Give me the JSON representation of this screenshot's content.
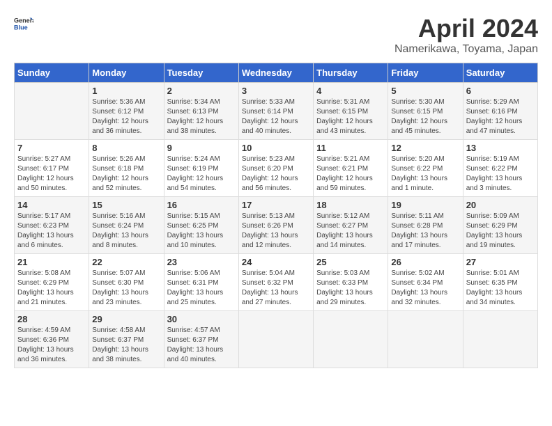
{
  "logo": {
    "line1": "General",
    "line2": "Blue"
  },
  "title": "April 2024",
  "subtitle": "Namerikawa, Toyama, Japan",
  "weekdays": [
    "Sunday",
    "Monday",
    "Tuesday",
    "Wednesday",
    "Thursday",
    "Friday",
    "Saturday"
  ],
  "weeks": [
    [
      {
        "day": "",
        "info": ""
      },
      {
        "day": "1",
        "info": "Sunrise: 5:36 AM\nSunset: 6:12 PM\nDaylight: 12 hours\nand 36 minutes."
      },
      {
        "day": "2",
        "info": "Sunrise: 5:34 AM\nSunset: 6:13 PM\nDaylight: 12 hours\nand 38 minutes."
      },
      {
        "day": "3",
        "info": "Sunrise: 5:33 AM\nSunset: 6:14 PM\nDaylight: 12 hours\nand 40 minutes."
      },
      {
        "day": "4",
        "info": "Sunrise: 5:31 AM\nSunset: 6:15 PM\nDaylight: 12 hours\nand 43 minutes."
      },
      {
        "day": "5",
        "info": "Sunrise: 5:30 AM\nSunset: 6:15 PM\nDaylight: 12 hours\nand 45 minutes."
      },
      {
        "day": "6",
        "info": "Sunrise: 5:29 AM\nSunset: 6:16 PM\nDaylight: 12 hours\nand 47 minutes."
      }
    ],
    [
      {
        "day": "7",
        "info": "Sunrise: 5:27 AM\nSunset: 6:17 PM\nDaylight: 12 hours\nand 50 minutes."
      },
      {
        "day": "8",
        "info": "Sunrise: 5:26 AM\nSunset: 6:18 PM\nDaylight: 12 hours\nand 52 minutes."
      },
      {
        "day": "9",
        "info": "Sunrise: 5:24 AM\nSunset: 6:19 PM\nDaylight: 12 hours\nand 54 minutes."
      },
      {
        "day": "10",
        "info": "Sunrise: 5:23 AM\nSunset: 6:20 PM\nDaylight: 12 hours\nand 56 minutes."
      },
      {
        "day": "11",
        "info": "Sunrise: 5:21 AM\nSunset: 6:21 PM\nDaylight: 12 hours\nand 59 minutes."
      },
      {
        "day": "12",
        "info": "Sunrise: 5:20 AM\nSunset: 6:22 PM\nDaylight: 13 hours\nand 1 minute."
      },
      {
        "day": "13",
        "info": "Sunrise: 5:19 AM\nSunset: 6:22 PM\nDaylight: 13 hours\nand 3 minutes."
      }
    ],
    [
      {
        "day": "14",
        "info": "Sunrise: 5:17 AM\nSunset: 6:23 PM\nDaylight: 13 hours\nand 6 minutes."
      },
      {
        "day": "15",
        "info": "Sunrise: 5:16 AM\nSunset: 6:24 PM\nDaylight: 13 hours\nand 8 minutes."
      },
      {
        "day": "16",
        "info": "Sunrise: 5:15 AM\nSunset: 6:25 PM\nDaylight: 13 hours\nand 10 minutes."
      },
      {
        "day": "17",
        "info": "Sunrise: 5:13 AM\nSunset: 6:26 PM\nDaylight: 13 hours\nand 12 minutes."
      },
      {
        "day": "18",
        "info": "Sunrise: 5:12 AM\nSunset: 6:27 PM\nDaylight: 13 hours\nand 14 minutes."
      },
      {
        "day": "19",
        "info": "Sunrise: 5:11 AM\nSunset: 6:28 PM\nDaylight: 13 hours\nand 17 minutes."
      },
      {
        "day": "20",
        "info": "Sunrise: 5:09 AM\nSunset: 6:29 PM\nDaylight: 13 hours\nand 19 minutes."
      }
    ],
    [
      {
        "day": "21",
        "info": "Sunrise: 5:08 AM\nSunset: 6:29 PM\nDaylight: 13 hours\nand 21 minutes."
      },
      {
        "day": "22",
        "info": "Sunrise: 5:07 AM\nSunset: 6:30 PM\nDaylight: 13 hours\nand 23 minutes."
      },
      {
        "day": "23",
        "info": "Sunrise: 5:06 AM\nSunset: 6:31 PM\nDaylight: 13 hours\nand 25 minutes."
      },
      {
        "day": "24",
        "info": "Sunrise: 5:04 AM\nSunset: 6:32 PM\nDaylight: 13 hours\nand 27 minutes."
      },
      {
        "day": "25",
        "info": "Sunrise: 5:03 AM\nSunset: 6:33 PM\nDaylight: 13 hours\nand 29 minutes."
      },
      {
        "day": "26",
        "info": "Sunrise: 5:02 AM\nSunset: 6:34 PM\nDaylight: 13 hours\nand 32 minutes."
      },
      {
        "day": "27",
        "info": "Sunrise: 5:01 AM\nSunset: 6:35 PM\nDaylight: 13 hours\nand 34 minutes."
      }
    ],
    [
      {
        "day": "28",
        "info": "Sunrise: 4:59 AM\nSunset: 6:36 PM\nDaylight: 13 hours\nand 36 minutes."
      },
      {
        "day": "29",
        "info": "Sunrise: 4:58 AM\nSunset: 6:37 PM\nDaylight: 13 hours\nand 38 minutes."
      },
      {
        "day": "30",
        "info": "Sunrise: 4:57 AM\nSunset: 6:37 PM\nDaylight: 13 hours\nand 40 minutes."
      },
      {
        "day": "",
        "info": ""
      },
      {
        "day": "",
        "info": ""
      },
      {
        "day": "",
        "info": ""
      },
      {
        "day": "",
        "info": ""
      }
    ]
  ]
}
